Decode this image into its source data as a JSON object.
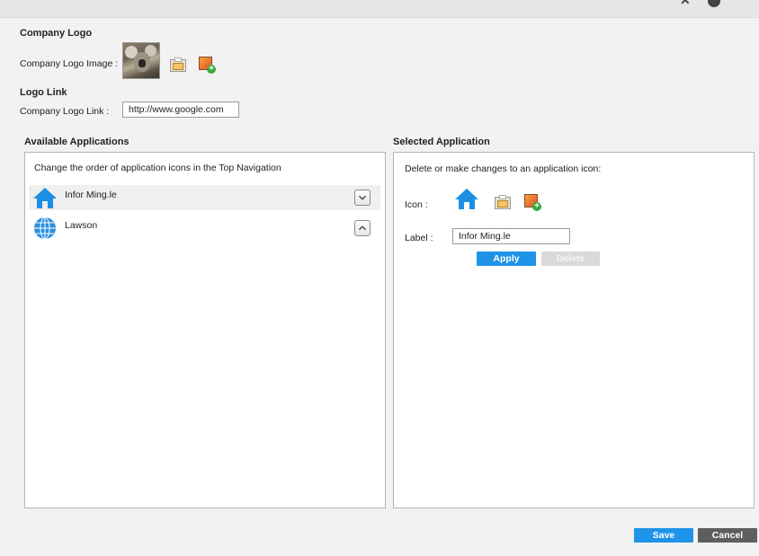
{
  "company_logo": {
    "heading": "Company Logo",
    "image_label": "Company Logo Image :",
    "folder_icon": "folder-image-icon",
    "add_icon": "add-image-icon"
  },
  "logo_link": {
    "heading": "Logo Link",
    "field_label": "Company Logo Link :",
    "value": "http://www.google.com"
  },
  "available_applications": {
    "heading": "Available Applications",
    "instruction": "Change the order of application icons in the Top Navigation",
    "items": [
      {
        "label": "Infor Ming.le",
        "icon": "home-icon",
        "arrow": "down"
      },
      {
        "label": "Lawson",
        "icon": "globe-icon",
        "arrow": "up"
      }
    ]
  },
  "selected_application": {
    "heading": "Selected Application",
    "instruction": "Delete or make changes to an application icon:",
    "icon_label": "Icon :",
    "label_label": "Label :",
    "label_value": "Infor Ming.le",
    "apply": "Apply",
    "delete": "Delete"
  },
  "footer": {
    "save": "Save",
    "cancel": "Cancel"
  },
  "colors": {
    "accent": "#1e93e8",
    "dark_button": "#5e5e5e",
    "disabled_button": "#d9d9d9"
  }
}
